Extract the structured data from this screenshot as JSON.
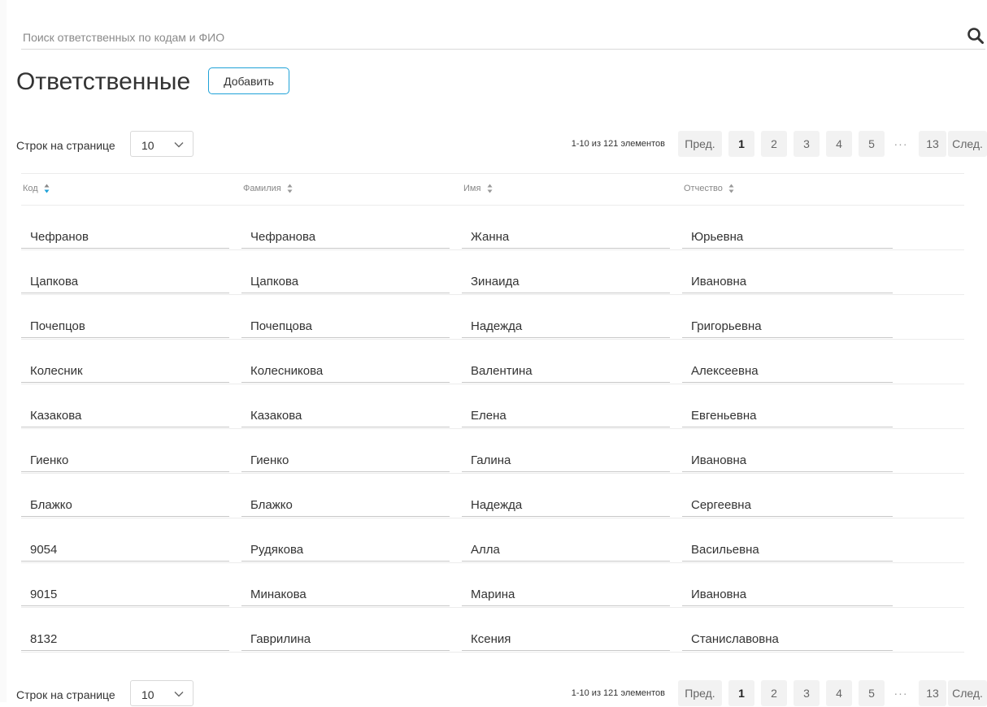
{
  "search": {
    "placeholder": "Поиск ответственных по кодам и ФИО",
    "icon": "search-icon"
  },
  "page": {
    "title": "Ответственные",
    "add_label": "Добавить"
  },
  "pagination": {
    "rows_label": "Строк на странице",
    "rows_value": "10",
    "range_text": "1-10 из 121 элементов",
    "prev_label": "Пред.",
    "next_label": "След.",
    "pages": [
      "1",
      "2",
      "3",
      "4",
      "5"
    ],
    "ellipsis": "···",
    "last_page": "13",
    "current_page": "1"
  },
  "table": {
    "columns": [
      "Код",
      "Фамилия",
      "Имя",
      "Отчество"
    ],
    "rows": [
      [
        "Чефранов",
        "Чефранова",
        "Жанна",
        "Юрьевна"
      ],
      [
        "Цапкова",
        "Цапкова",
        "Зинаида",
        "Ивановна"
      ],
      [
        "Почепцов",
        "Почепцова",
        "Надежда",
        "Григорьевна"
      ],
      [
        "Колесник",
        "Колесникова",
        "Валентина",
        "Алексеевна"
      ],
      [
        "Казакова",
        "Казакова",
        "Елена",
        "Евгеньевна"
      ],
      [
        "Гиенко",
        "Гиенко",
        "Галина",
        "Ивановна"
      ],
      [
        "Блажко",
        "Блажко",
        "Надежда",
        "Сергеевна"
      ],
      [
        "9054",
        "Рудякова",
        "Алла",
        "Васильевна"
      ],
      [
        "9015",
        "Минакова",
        "Марина",
        "Ивановна"
      ],
      [
        "8132",
        "Гаврилина",
        "Ксения",
        "Станиславовна"
      ]
    ]
  },
  "colors": {
    "accent": "#1fa2d8",
    "sort_active": "#1fa2d8",
    "pager_bg": "#f2f2f2"
  }
}
